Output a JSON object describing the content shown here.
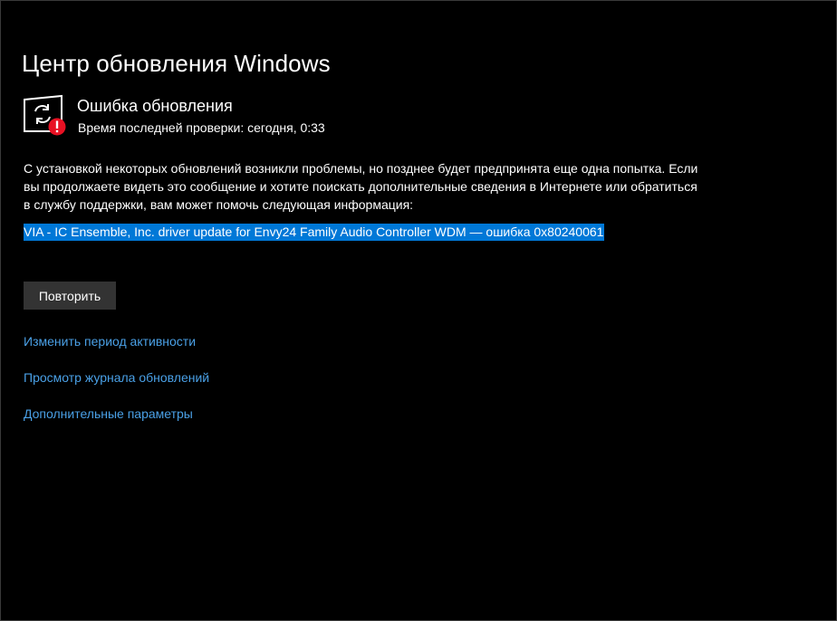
{
  "header": {
    "title": "Центр обновления Windows"
  },
  "status": {
    "icon": "sync-error-icon",
    "title": "Ошибка обновления",
    "last_check": "Время последней проверки: сегодня, 0:33"
  },
  "message": {
    "lines": [
      "С установкой некоторых обновлений возникли проблемы, но позднее будет предпринята еще одна попытка. Если",
      "вы продолжаете видеть это сообщение и хотите поискать дополнительные сведения в Интернете или обратиться",
      "в службу поддержки, вам может помочь следующая информация:"
    ]
  },
  "error": {
    "detail": "VIA - IC Ensemble, Inc. driver update for Envy24 Family Audio Controller WDM — ошибка 0x80240061"
  },
  "actions": {
    "retry_label": "Повторить"
  },
  "links": {
    "active_hours": "Изменить период активности",
    "update_history": "Просмотр журнала обновлений",
    "advanced_options": "Дополнительные параметры"
  },
  "colors": {
    "background": "#000000",
    "text": "#ffffff",
    "link": "#4aa0e6",
    "selection": "#0078d7",
    "button": "#333333",
    "error_badge": "#e81123"
  }
}
